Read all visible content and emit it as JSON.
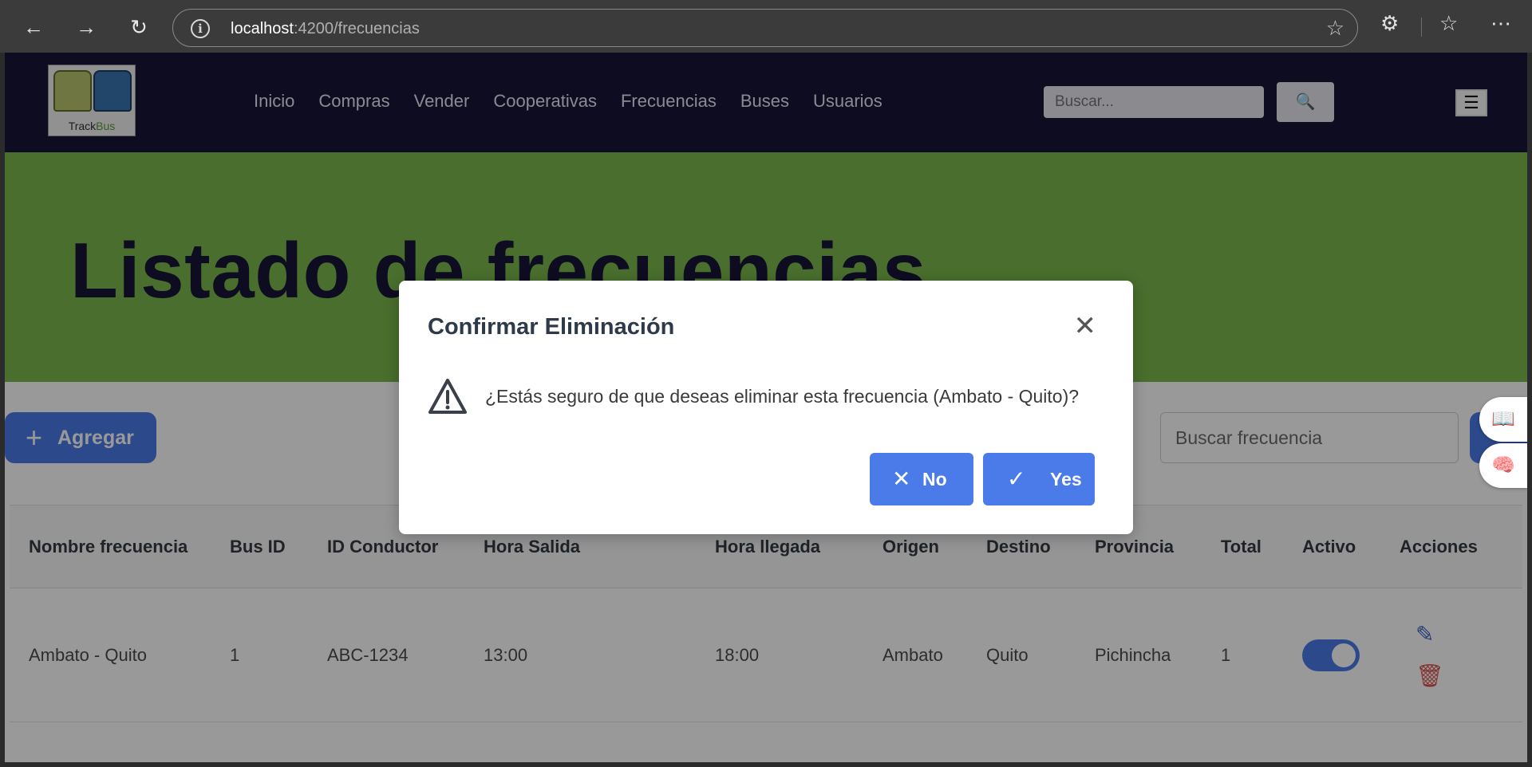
{
  "browser": {
    "url_host": "localhost",
    "url_path": ":4200/frecuencias"
  },
  "nav": {
    "logo_text_a": "Track",
    "logo_text_b": "Bus",
    "items": [
      "Inicio",
      "Compras",
      "Vender",
      "Cooperativas",
      "Frecuencias",
      "Buses",
      "Usuarios"
    ],
    "search_placeholder": "Buscar...",
    "search_icon": "🔍",
    "menu_icon": "☰"
  },
  "banner": {
    "title": "Listado de frecuencias"
  },
  "toolbar": {
    "add_label": "Agregar",
    "add_icon": "+",
    "search_placeholder": "Buscar frecuencia"
  },
  "table": {
    "headers": [
      "Nombre frecuencia",
      "Bus ID",
      "ID Conductor",
      "Hora Salida",
      "Hora llegada",
      "Origen",
      "Destino",
      "Provincia",
      "Total",
      "Activo",
      "Acciones"
    ],
    "rows": [
      {
        "nombre": "Ambato - Quito",
        "bus_id": "1",
        "conductor": "ABC-1234",
        "salida": "13:00",
        "llegada": "18:00",
        "origen": "Ambato",
        "destino": "Quito",
        "provincia": "Pichincha",
        "total": "1",
        "activo": true
      }
    ]
  },
  "dialog": {
    "title": "Confirmar Eliminación",
    "close_icon": "✕",
    "message": "¿Estás seguro de que deseas eliminar esta frecuencia (Ambato - Quito)?",
    "no_label": "No",
    "no_icon": "✕",
    "yes_label": "Yes",
    "yes_icon": "✓"
  },
  "colors": {
    "nav_bg": "#161537",
    "banner_bg": "#7ab84b",
    "primary": "#4a7be8",
    "delete_icon": "#d9534f"
  }
}
